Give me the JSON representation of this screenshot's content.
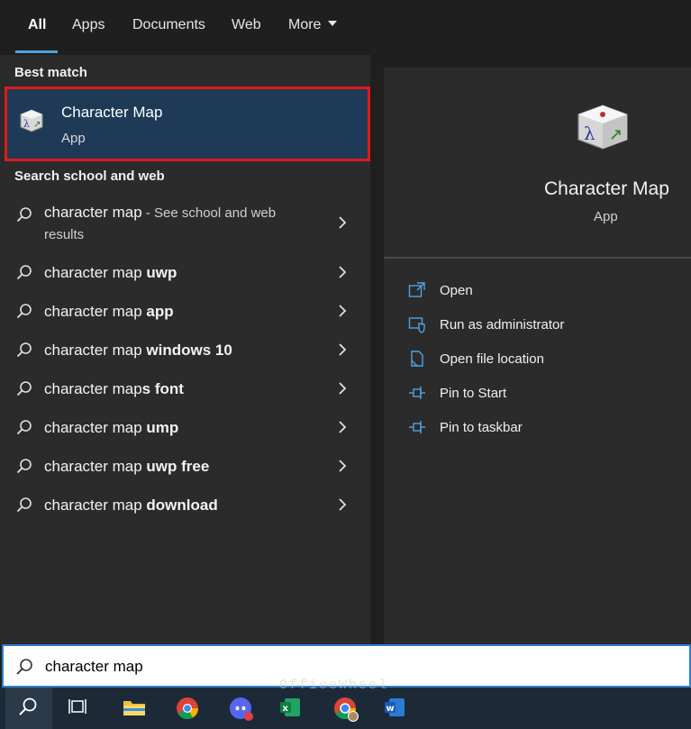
{
  "tabs": [
    {
      "label": "All",
      "active": true
    },
    {
      "label": "Apps"
    },
    {
      "label": "Documents"
    },
    {
      "label": "Web"
    },
    {
      "label": "More"
    }
  ],
  "best_match": {
    "section_title": "Best match",
    "name": "Character Map",
    "type": "App",
    "icon": "character-map-icon"
  },
  "web_section": {
    "title": "Search school and web",
    "suggestions": [
      {
        "normal": "character map",
        "bold": "",
        "suffix": " - See school and web",
        "line2": "results"
      },
      {
        "normal": "character map ",
        "bold": "uwp"
      },
      {
        "normal": "character map ",
        "bold": "app"
      },
      {
        "normal": "character map ",
        "bold": "windows 10"
      },
      {
        "normal": "character map",
        "bold": "s font"
      },
      {
        "normal": "character map ",
        "bold": "ump"
      },
      {
        "normal": "character map ",
        "bold": "uwp free"
      },
      {
        "normal": "character map ",
        "bold": "download"
      }
    ]
  },
  "preview": {
    "name": "Character Map",
    "type": "App",
    "actions": [
      {
        "label": "Open",
        "icon": "open-icon"
      },
      {
        "label": "Run as administrator",
        "icon": "shield-icon"
      },
      {
        "label": "Open file location",
        "icon": "file-location-icon"
      },
      {
        "label": "Pin to Start",
        "icon": "pin-icon"
      },
      {
        "label": "Pin to taskbar",
        "icon": "pin-icon"
      }
    ]
  },
  "search": {
    "value": "character map"
  },
  "taskbar": {
    "items": [
      "search-icon",
      "task-view-icon",
      "file-explorer-icon",
      "chrome-icon",
      "discord-icon",
      "excel-icon",
      "chrome-profile-icon",
      "word-icon"
    ]
  },
  "watermark": "OfficeWheel",
  "colors": {
    "accent": "#4ea3e0",
    "highlight_border": "#e01b1b",
    "selected_bg": "#1e3a57"
  }
}
